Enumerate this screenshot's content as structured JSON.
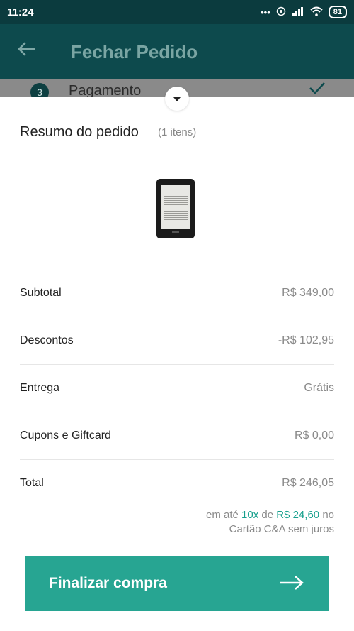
{
  "status_bar": {
    "time": "11:24",
    "signal_text": "•••",
    "battery": "81"
  },
  "app_bar": {
    "back_icon": "arrow-left-icon",
    "title": "Fechar Pedido"
  },
  "step": {
    "number": "3",
    "label": "Pagamento",
    "check_icon": "checkmark-icon"
  },
  "sheet": {
    "handle_icon": "chevron-down-icon",
    "title": "Resumo do pedido",
    "count": "(1 itens)",
    "product_image": "ereader-image",
    "rows": [
      {
        "label": "Subtotal",
        "value": "R$ 349,00"
      },
      {
        "label": "Descontos",
        "value": "-R$ 102,95"
      },
      {
        "label": "Entrega",
        "value": "Grátis"
      },
      {
        "label": "Cupons e Giftcard",
        "value": "R$ 0,00"
      },
      {
        "label": "Total",
        "value": "R$ 246,05"
      }
    ],
    "installments": {
      "prefix": "em até",
      "count": "10x",
      "middle": "de",
      "amount": "R$ 24,60",
      "suffix": "no",
      "line2": "Cartão C&A sem juros"
    }
  },
  "cta": {
    "label": "Finalizar compra",
    "arrow_icon": "arrow-right-icon"
  },
  "colors": {
    "accent": "#27a592",
    "header": "#0d4a4d",
    "muted": "#8a8a8a"
  }
}
